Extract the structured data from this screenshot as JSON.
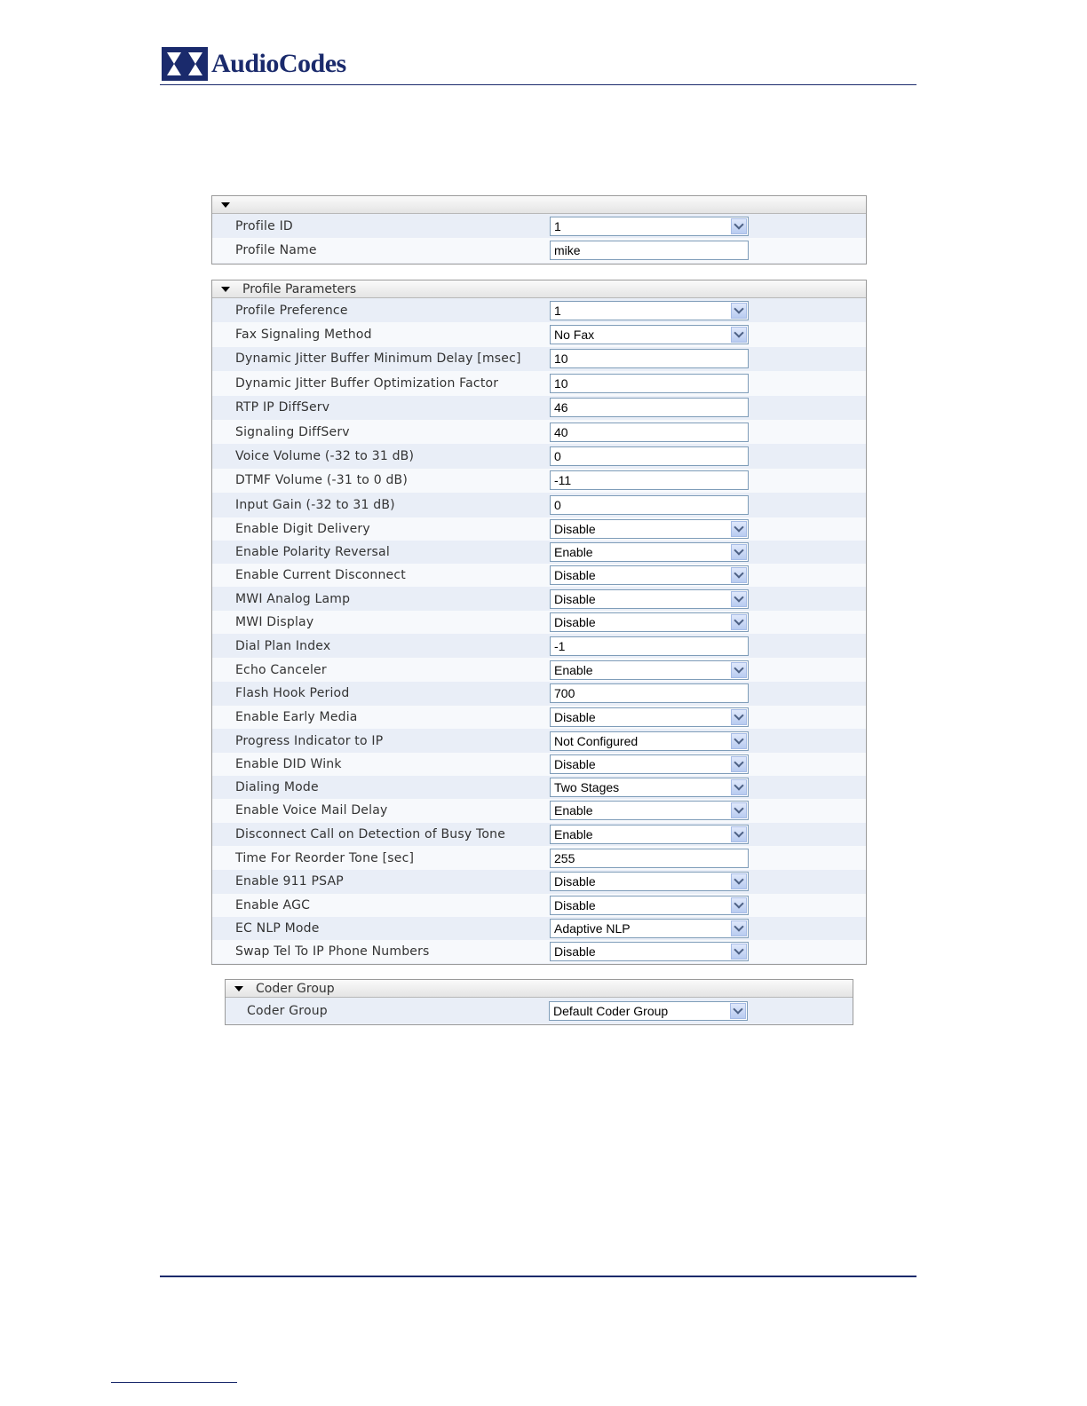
{
  "header": {
    "logo_text": "AudioCodes"
  },
  "profile_section": {
    "title": "",
    "rows": [
      {
        "label": "Profile ID",
        "type": "select",
        "value": "1"
      },
      {
        "label": "Profile Name",
        "type": "input",
        "value": "mike"
      }
    ]
  },
  "profile_parameters": {
    "title": "Profile Parameters",
    "rows": [
      {
        "label": "Profile Preference",
        "type": "select",
        "value": "1"
      },
      {
        "label": "Fax Signaling Method",
        "type": "select",
        "value": "No Fax"
      },
      {
        "label": "Dynamic Jitter Buffer Minimum Delay [msec]",
        "type": "input",
        "value": "10"
      },
      {
        "label": "Dynamic Jitter Buffer Optimization Factor",
        "type": "input",
        "value": "10"
      },
      {
        "label": "RTP IP DiffServ",
        "type": "input",
        "value": "46"
      },
      {
        "label": "Signaling DiffServ",
        "type": "input",
        "value": "40"
      },
      {
        "label": "Voice Volume (-32 to 31 dB)",
        "type": "input",
        "value": "0"
      },
      {
        "label": "DTMF Volume (-31 to 0 dB)",
        "type": "input",
        "value": "-11"
      },
      {
        "label": "Input Gain (-32 to 31 dB)",
        "type": "input",
        "value": "0"
      },
      {
        "label": "Enable Digit Delivery",
        "type": "select",
        "value": "Disable"
      },
      {
        "label": "Enable Polarity Reversal",
        "type": "select",
        "value": "Enable"
      },
      {
        "label": "Enable Current Disconnect",
        "type": "select",
        "value": "Disable"
      },
      {
        "label": "MWI Analog Lamp",
        "type": "select",
        "value": "Disable"
      },
      {
        "label": "MWI Display",
        "type": "select",
        "value": "Disable"
      },
      {
        "label": "Dial Plan Index",
        "type": "input",
        "value": "-1"
      },
      {
        "label": "Echo Canceler",
        "type": "select",
        "value": "Enable"
      },
      {
        "label": "Flash Hook Period",
        "type": "input",
        "value": "700"
      },
      {
        "label": "Enable Early Media",
        "type": "select",
        "value": "Disable"
      },
      {
        "label": "Progress Indicator to IP",
        "type": "select",
        "value": "Not Configured"
      },
      {
        "label": "Enable DID Wink",
        "type": "select",
        "value": "Disable"
      },
      {
        "label": "Dialing Mode",
        "type": "select",
        "value": "Two Stages"
      },
      {
        "label": "Enable Voice Mail Delay",
        "type": "select",
        "value": "Enable"
      },
      {
        "label": "Disconnect Call on Detection of Busy Tone",
        "type": "select",
        "value": "Enable"
      },
      {
        "label": "Time For Reorder Tone [sec]",
        "type": "input",
        "value": "255"
      },
      {
        "label": "Enable 911 PSAP",
        "type": "select",
        "value": "Disable"
      },
      {
        "label": "Enable AGC",
        "type": "select",
        "value": "Disable"
      },
      {
        "label": "EC NLP Mode",
        "type": "select",
        "value": "Adaptive NLP"
      },
      {
        "label": "Swap Tel To IP Phone Numbers",
        "type": "select",
        "value": "Disable"
      }
    ]
  },
  "coder_group": {
    "title": "Coder Group",
    "rows": [
      {
        "label": "Coder Group",
        "type": "select",
        "value": "Default Coder Group"
      }
    ]
  },
  "colors": {
    "brand": "#1a2a6c",
    "border": "#7f9db9"
  }
}
